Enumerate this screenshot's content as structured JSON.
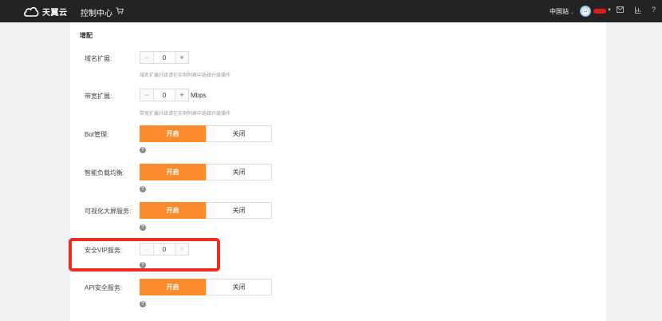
{
  "topbar": {
    "brand": "天翼云",
    "console": "控制中心",
    "region": "中国站",
    "icons": [
      "cloud-logo-icon",
      "cart-icon",
      "mail-icon",
      "order-icon",
      "help-icon"
    ]
  },
  "section": {
    "title": "增配"
  },
  "rows": {
    "domain": {
      "label": "域名扩展:",
      "value": "0",
      "hint": "域名扩展升级请在实例列表中选择升级操作"
    },
    "bandwidth": {
      "label": "带宽扩展:",
      "value": "0",
      "unit": "Mbps",
      "hint": "带宽扩展升级请在实例列表中选择升级操作"
    },
    "bot": {
      "label": "Bot管理:",
      "on": "开启",
      "off": "关闭"
    },
    "lb": {
      "label": "智能负载均衡:",
      "on": "开启",
      "off": "关闭"
    },
    "screen": {
      "label": "可视化大屏服务:",
      "on": "开启",
      "off": "关闭"
    },
    "vip": {
      "label": "安全VIP服务:",
      "value": "0"
    },
    "api": {
      "label": "API安全服务:",
      "on": "开启",
      "off": "关闭"
    }
  },
  "controls": {
    "minus": "−",
    "plus": "+",
    "help": "?"
  },
  "colors": {
    "accent": "#f98a2d",
    "topbar": "#232323",
    "highlight": "#ee2b1e"
  }
}
